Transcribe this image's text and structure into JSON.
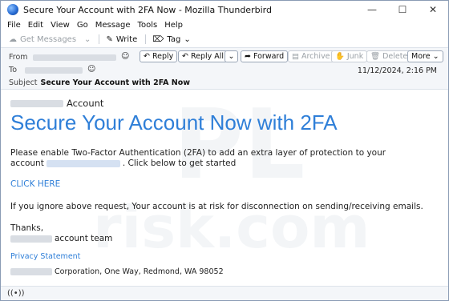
{
  "window": {
    "title": "Secure Your Account with 2FA Now - Mozilla Thunderbird",
    "controls": [
      "—",
      "☐",
      "✕"
    ]
  },
  "menu": [
    "File",
    "Edit",
    "View",
    "Go",
    "Message",
    "Tools",
    "Help"
  ],
  "toolbar": {
    "get_messages": "Get Messages",
    "write": "Write",
    "tag": "Tag"
  },
  "header": {
    "from_label": "From",
    "to_label": "To",
    "subject_label": "Subject",
    "subject": "Secure Your Account with 2FA Now",
    "date": "11/12/2024, 2:16 PM",
    "buttons": {
      "reply": "Reply",
      "reply_all": "Reply All",
      "forward": "Forward",
      "archive": "Archive",
      "junk": "Junk",
      "delete": "Delete",
      "more": "More"
    }
  },
  "message": {
    "brand_suffix": "Account",
    "headline": "Secure Your Account Now with 2FA",
    "line1": "Please enable Two-Factor Authentication (2FA) to add an extra layer of protection to your",
    "line2_prefix": "account",
    "line2_suffix": ". Click below to get started",
    "cta": "CLICK HERE",
    "warning": "If you ignore above request, Your account is at risk for disconnection on sending/receiving emails.",
    "thanks": "Thanks,",
    "team_suffix": "account team",
    "privacy": "Privacy Statement",
    "address_suffix": "Corporation, One Way, Redmond, WA 98052"
  },
  "watermark": {
    "top": "PL",
    "bottom": "risk.com"
  },
  "status": {
    "icon": "((•))"
  }
}
